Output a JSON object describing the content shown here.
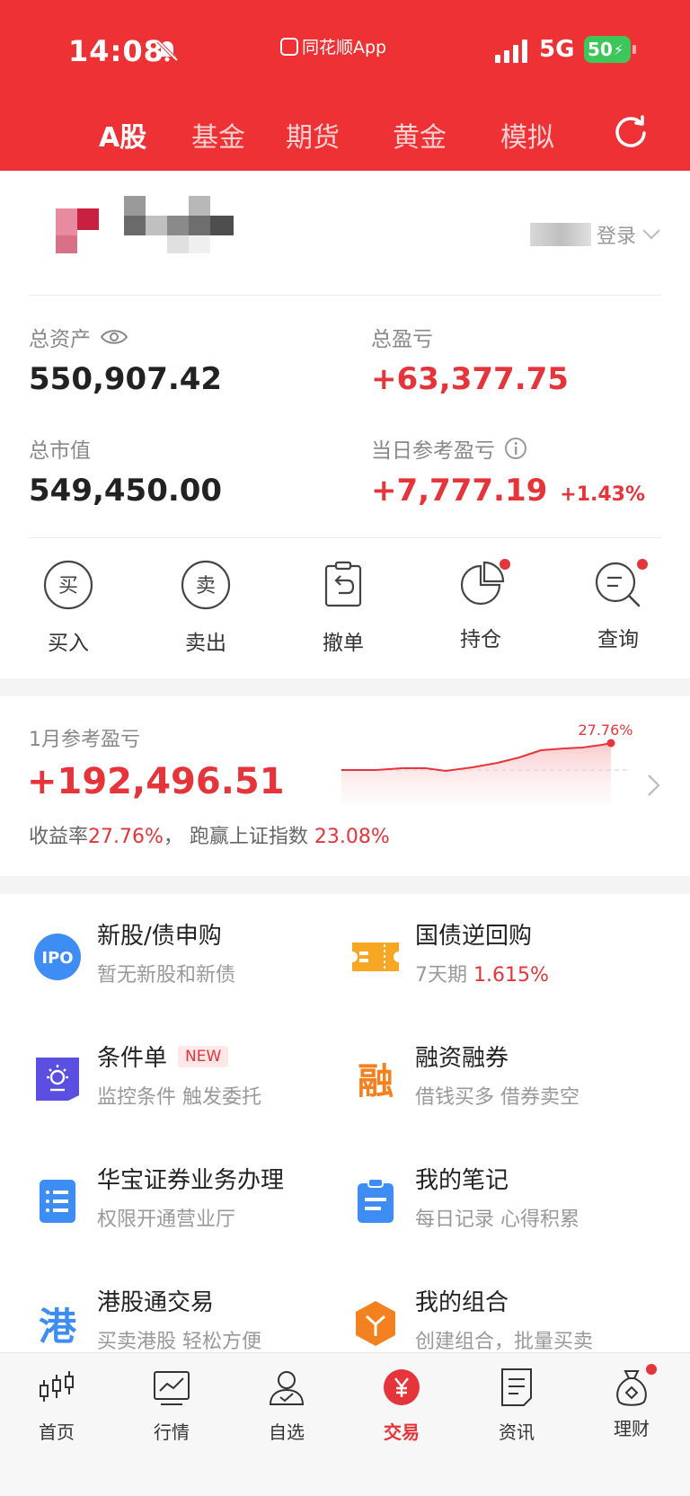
{
  "status_bar": {
    "time": "14:08",
    "app_label": "同花顺App",
    "network": "5G",
    "battery": "50"
  },
  "top_tabs": [
    {
      "label": "A股",
      "active": true
    },
    {
      "label": "基金",
      "active": false
    },
    {
      "label": "期货",
      "active": false
    },
    {
      "label": "黄金",
      "active": false
    },
    {
      "label": "模拟",
      "active": false
    }
  ],
  "account": {
    "login_text": "登录"
  },
  "stats": {
    "total_assets_label": "总资产",
    "total_assets_value": "550,907.42",
    "total_pl_label": "总盈亏",
    "total_pl_value": "+63,377.75",
    "market_value_label": "总市值",
    "market_value_value": "549,450.00",
    "daily_pl_label": "当日参考盈亏",
    "daily_pl_value": "+7,777.19",
    "daily_pl_pct": "+1.43%"
  },
  "actions": [
    {
      "label": "买入",
      "icon": "buy-icon",
      "glyph": "买"
    },
    {
      "label": "卖出",
      "icon": "sell-icon",
      "glyph": "卖"
    },
    {
      "label": "撤单",
      "icon": "cancel-order-icon"
    },
    {
      "label": "持仓",
      "icon": "positions-icon"
    },
    {
      "label": "查询",
      "icon": "query-icon"
    }
  ],
  "monthly": {
    "label": "1月参考盈亏",
    "value": "+192,496.51",
    "rate_prefix": "收益率",
    "rate_value": "27.76%",
    "rate_mid": "，  跑赢上证指数",
    "beat_value": "23.08%",
    "chart_end_label": "27.76%"
  },
  "services": [
    {
      "title": "新股/债申购",
      "sub": "暂无新股和新债",
      "icon": "ipo-icon",
      "icon_text": "IPO"
    },
    {
      "title": "国债逆回购",
      "sub_prefix": "7天期 ",
      "sub_red": "1.615%",
      "icon": "ticket-icon"
    },
    {
      "title": "条件单",
      "badge": "NEW",
      "sub": "监控条件 触发委托",
      "icon": "condition-order-icon"
    },
    {
      "title": "融资融券",
      "sub": "借钱买多 借券卖空",
      "icon": "margin-icon",
      "icon_text": "融"
    },
    {
      "title": "华宝证券业务办理",
      "sub": "权限开通营业厅",
      "icon": "list-icon"
    },
    {
      "title": "我的笔记",
      "sub": "每日记录 心得积累",
      "icon": "notes-icon"
    },
    {
      "title": "港股通交易",
      "sub": "买卖港股 轻松方便",
      "icon": "hk-connect-icon",
      "icon_text": "港"
    },
    {
      "title": "我的组合",
      "sub": "创建组合，批量买卖",
      "icon": "portfolio-icon"
    }
  ],
  "bottom_nav": [
    {
      "label": "首页",
      "icon": "candlestick-icon"
    },
    {
      "label": "行情",
      "icon": "market-chart-icon"
    },
    {
      "label": "自选",
      "icon": "user-watchlist-icon"
    },
    {
      "label": "交易",
      "icon": "trade-yen-icon",
      "active": true
    },
    {
      "label": "资讯",
      "icon": "news-icon"
    },
    {
      "label": "理财",
      "icon": "wealth-bag-icon"
    }
  ],
  "colors": {
    "brand_red": "#ee3135",
    "value_red": "#e5343a",
    "battery_green": "#3dc75a"
  }
}
